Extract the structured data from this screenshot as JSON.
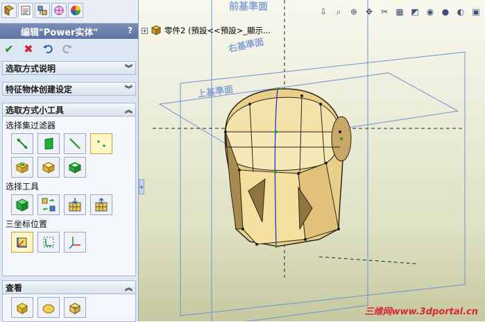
{
  "feature": {
    "title": "编辑\"Power实体\"",
    "help": "?"
  },
  "sections": {
    "selection_help": {
      "label": "选取方式说明"
    },
    "feature_settings": {
      "label": "特征物体创建设定"
    },
    "selection_tools": {
      "label": "选取方式小工具",
      "filter_label": "选择集过滤器",
      "select_tools_label": "选择工具",
      "triad_label": "三坐标位置"
    },
    "view": {
      "label": "查看"
    }
  },
  "tree": {
    "node_label": "零件2 (預設<<預設>_顯示..."
  },
  "canvas": {
    "plane_front": "前基準面",
    "plane_right": "右基準面",
    "plane_top": "上基準面"
  },
  "watermark": {
    "text": "三维网www.3dportal.cn"
  }
}
